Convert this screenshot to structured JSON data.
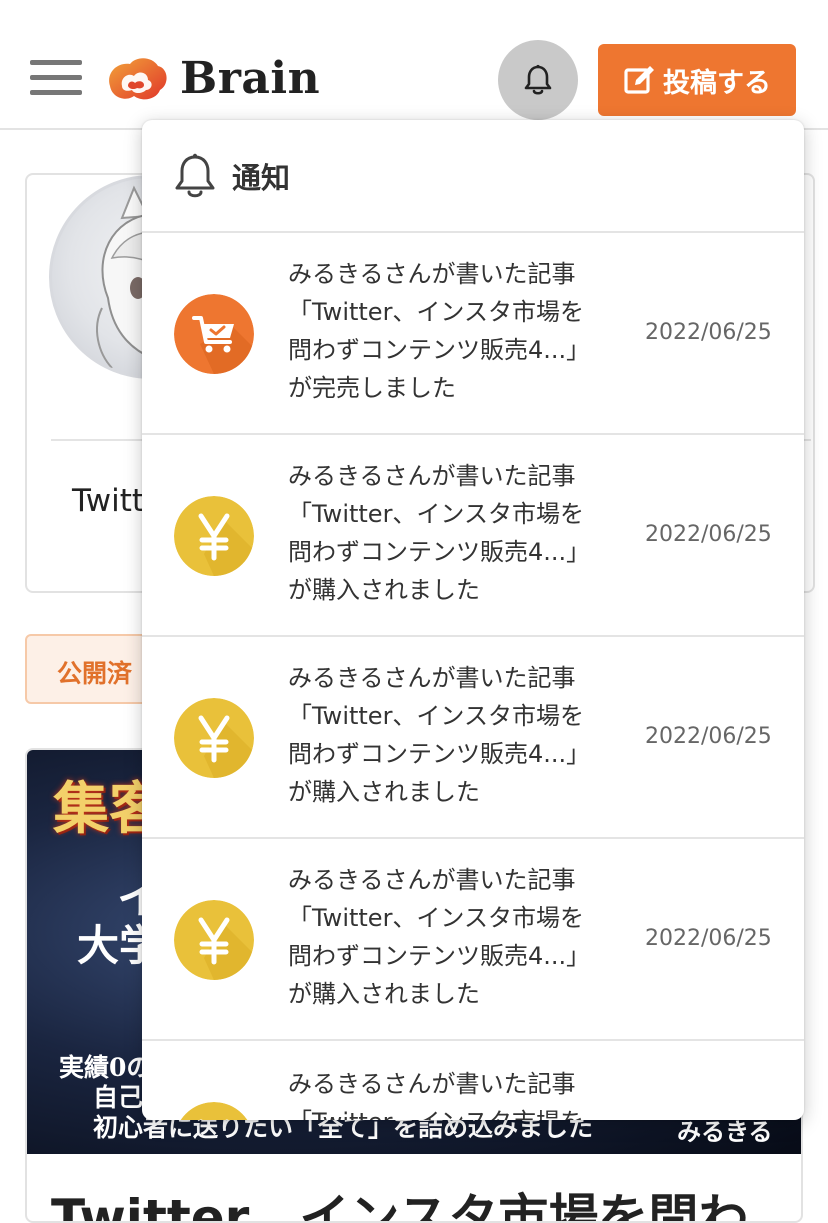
{
  "header": {
    "logo_text": "Brain",
    "post_button_label": "投稿する"
  },
  "background": {
    "profile_name": "Twitt",
    "tab_published": "公開済",
    "thumb_line1": "集客",
    "thumb_line2": "イ",
    "thumb_line3": "大学",
    "thumb_line4": "実績0の",
    "thumb_line5": "自己",
    "thumb_line6": "初心者に送りたい「全て」を詰め込みました",
    "thumb_author": "みるきる",
    "article_title": "Twitter、インスタ市場を問わ"
  },
  "notifications": {
    "title": "通知",
    "items": [
      {
        "icon": "cart-check-icon",
        "line1": "みるきるさんが書いた記事",
        "line2": "「Twitter、インスタ市場を",
        "line3": "問わずコンテンツ販売4...」",
        "line4": "が完売しました",
        "date": "2022/06/25"
      },
      {
        "icon": "yen-icon",
        "line1": "みるきるさんが書いた記事",
        "line2": "「Twitter、インスタ市場を",
        "line3": "問わずコンテンツ販売4...」",
        "line4": "が購入されました",
        "date": "2022/06/25"
      },
      {
        "icon": "yen-icon",
        "line1": "みるきるさんが書いた記事",
        "line2": "「Twitter、インスタ市場を",
        "line3": "問わずコンテンツ販売4...」",
        "line4": "が購入されました",
        "date": "2022/06/25"
      },
      {
        "icon": "yen-icon",
        "line1": "みるきるさんが書いた記事",
        "line2": "「Twitter、インスタ市場を",
        "line3": "問わずコンテンツ販売4...」",
        "line4": "が購入されました",
        "date": "2022/06/25"
      },
      {
        "icon": "yen-icon",
        "line1": "みるきるさんが書いた記事",
        "line2": "「Twitter、インスタ市場を",
        "line3": "",
        "line4": "",
        "date": ""
      }
    ]
  },
  "colors": {
    "accent": "#ee7630",
    "yen_coin": "#e9c13a",
    "bell_button": "#c9c9c9"
  }
}
